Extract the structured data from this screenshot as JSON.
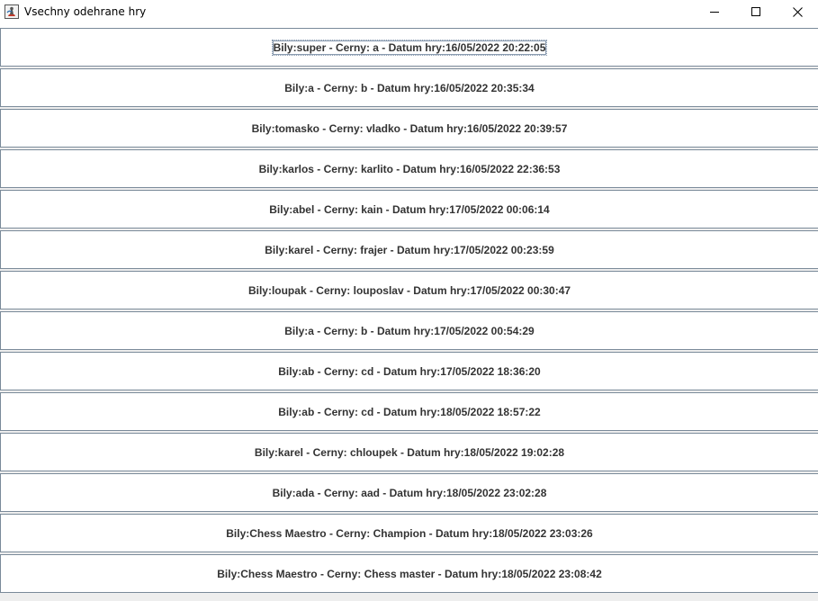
{
  "window": {
    "title": "Vsechny odehrane hry"
  },
  "colors": {
    "row_border": "#7a8a99",
    "row_background": "#ffffff",
    "text": "#333333"
  },
  "games": [
    {
      "label": "Bily:super - Cerny: a - Datum hry:16/05/2022 20:22:05"
    },
    {
      "label": "Bily:a - Cerny: b - Datum hry:16/05/2022 20:35:34"
    },
    {
      "label": "Bily:tomasko - Cerny: vladko - Datum hry:16/05/2022 20:39:57"
    },
    {
      "label": "Bily:karlos - Cerny: karlito - Datum hry:16/05/2022 22:36:53"
    },
    {
      "label": "Bily:abel - Cerny: kain - Datum hry:17/05/2022 00:06:14"
    },
    {
      "label": "Bily:karel - Cerny: frajer - Datum hry:17/05/2022 00:23:59"
    },
    {
      "label": "Bily:loupak - Cerny: louposlav - Datum hry:17/05/2022 00:30:47"
    },
    {
      "label": "Bily:a - Cerny: b - Datum hry:17/05/2022 00:54:29"
    },
    {
      "label": "Bily:ab - Cerny: cd - Datum hry:17/05/2022 18:36:20"
    },
    {
      "label": "Bily:ab - Cerny: cd - Datum hry:18/05/2022 18:57:22"
    },
    {
      "label": "Bily:karel - Cerny: chloupek - Datum hry:18/05/2022 19:02:28"
    },
    {
      "label": "Bily:ada - Cerny: aad - Datum hry:18/05/2022 23:02:28"
    },
    {
      "label": "Bily:Chess Maestro - Cerny: Champion - Datum hry:18/05/2022 23:03:26"
    },
    {
      "label": "Bily:Chess Maestro - Cerny: Chess master - Datum hry:18/05/2022 23:08:42"
    }
  ]
}
